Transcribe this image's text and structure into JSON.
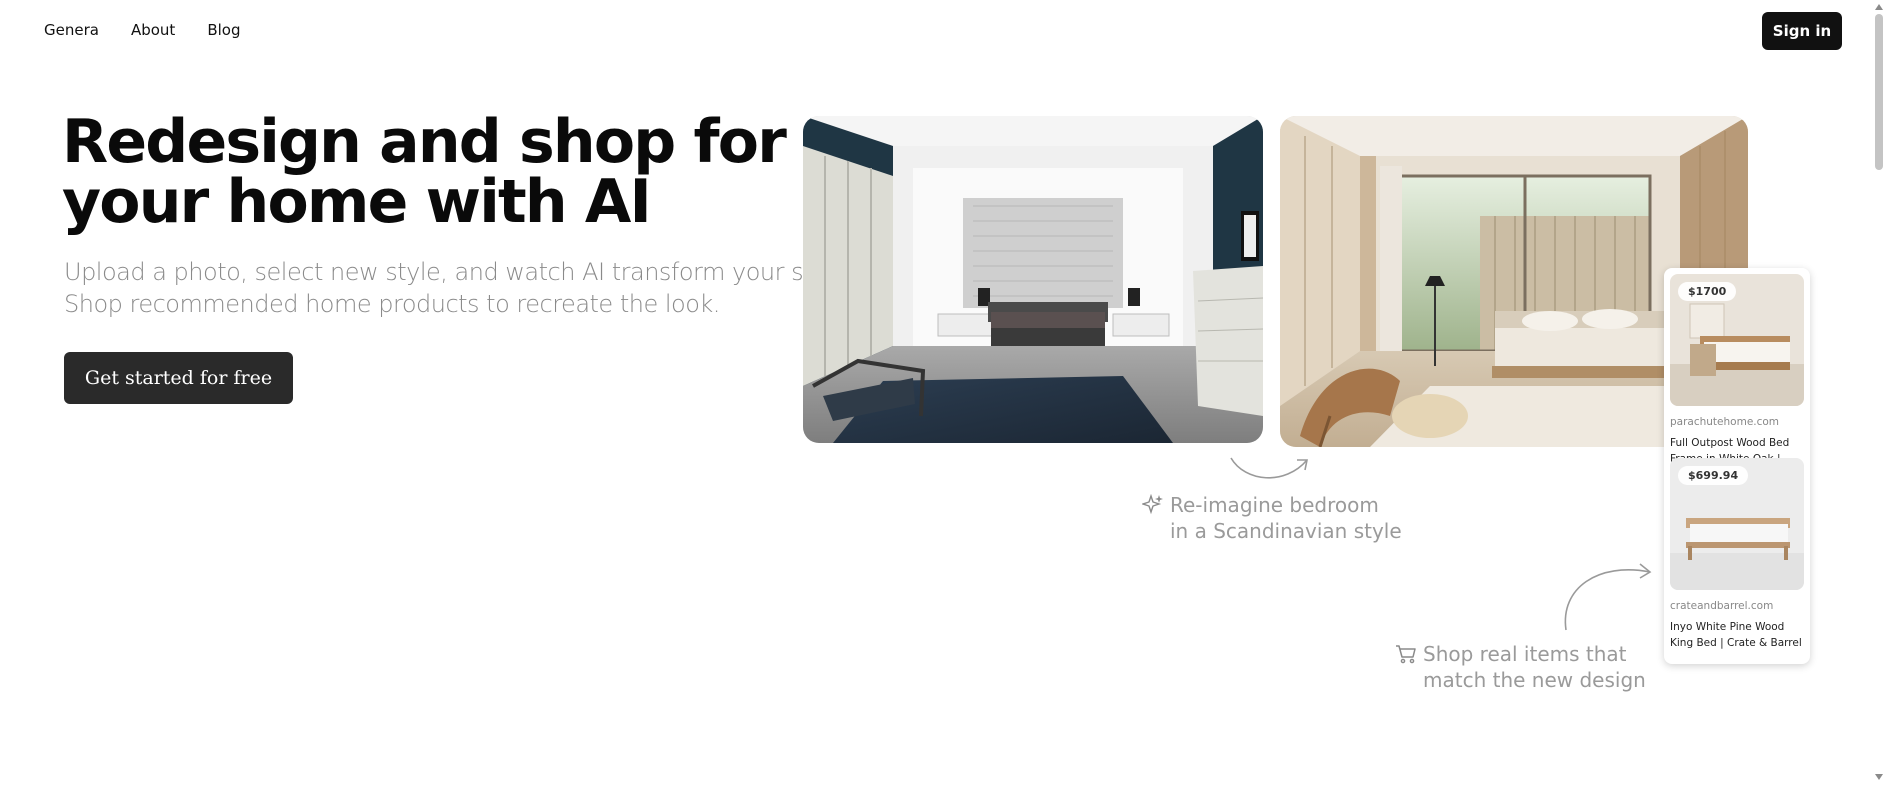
{
  "nav": {
    "links": [
      "Genera",
      "About",
      "Blog"
    ],
    "signin_label": "Sign in"
  },
  "hero": {
    "title": "Redesign and shop for your home with AI",
    "subtitle_lines": [
      "Upload a photo, select new style, and watch AI transform your space.",
      "Shop recommended home products to recreate the look."
    ],
    "cta_label": "Get started for free"
  },
  "annotations": {
    "reimagine": {
      "icon": "sparkle-icon",
      "lines": [
        "Re-imagine bedroom",
        "in a Scandinavian style"
      ]
    },
    "shop": {
      "icon": "cart-icon",
      "lines": [
        "Shop real items that",
        "match the new design"
      ]
    }
  },
  "products": [
    {
      "price": "$1700",
      "domain": "parachutehome.com",
      "title": "Full Outpost Wood Bed Frame in White Oak | Casegoo..."
    },
    {
      "price": "$699.94",
      "domain": "crateandbarrel.com",
      "title": "Inyo White Pine Wood King Bed | Crate & Barrel"
    }
  ],
  "colors": {
    "primary_button": "#111111",
    "cta_button": "#2a2a2a",
    "muted_text": "#8a8a8a",
    "annotation_text": "#9a9a9a"
  }
}
